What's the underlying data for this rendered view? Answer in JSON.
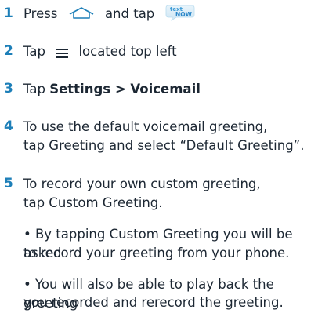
{
  "steps": [
    {
      "number": "1",
      "text_before": "Press",
      "text_after": "and tap",
      "app_icon": "textnow-app-icon",
      "app_icon_text": [
        "text",
        "NOW"
      ]
    },
    {
      "number": "2",
      "text_before": "Tap",
      "text_after": "located top left"
    },
    {
      "number": "3",
      "text_before": "Tap",
      "bold_1": "Settings",
      "separator": " > ",
      "bold_2": "Voicemail"
    },
    {
      "number": "4",
      "line1": "To use the default voicemail greeting,",
      "line2": "tap Greeting and select “Default Greeting”."
    },
    {
      "number": "5",
      "line1": "To record your own custom greeting,",
      "line2": "tap Custom Greeting."
    }
  ],
  "bullets": [
    {
      "line1": "• By tapping Custom Greeting you will be asked",
      "line2": "to record your greeting from your phone."
    },
    {
      "line1": "• You will also be able to play back the greeting",
      "line2": "you recorded and rerecord the greeting."
    }
  ],
  "colors": {
    "step_number": "#1d7fb8",
    "icon_stroke": "#1d7fb8",
    "text": "#1c2733"
  },
  "icons": {
    "home": "home-icon",
    "menu": "hamburger-menu-icon"
  }
}
